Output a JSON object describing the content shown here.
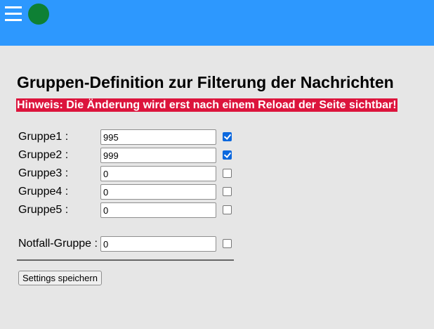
{
  "colors": {
    "header": "#2d98fe",
    "status_dot": "#0e8034",
    "notice_bg": "#dc143c"
  },
  "header": {
    "menu_icon": "hamburger-icon",
    "status_icon": "green-circle"
  },
  "title": "Gruppen-Definition zur Filterung der Nachrichten",
  "notice": "Hinweis: Die Änderung wird erst nach einem Reload der Seite sichtbar!",
  "groups": [
    {
      "label": "Gruppe1 :",
      "value": "995",
      "checked": true
    },
    {
      "label": "Gruppe2 :",
      "value": "999",
      "checked": true
    },
    {
      "label": "Gruppe3 :",
      "value": "0",
      "checked": false
    },
    {
      "label": "Gruppe4 :",
      "value": "0",
      "checked": false
    },
    {
      "label": "Gruppe5 :",
      "value": "0",
      "checked": false
    }
  ],
  "emergency": {
    "label": "Notfall-Gruppe :",
    "value": "0",
    "checked": false
  },
  "save_label": "Settings speichern"
}
